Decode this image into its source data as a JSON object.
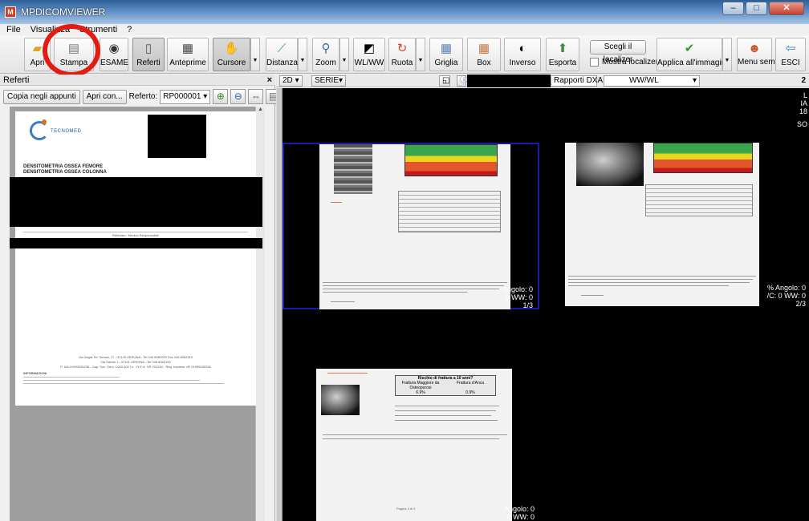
{
  "window": {
    "title": "MPDICOMVIEWER",
    "minimize": "–",
    "maximize": "□",
    "close": "✕"
  },
  "menu": [
    "File",
    "Visualizza",
    "Strumenti",
    "?"
  ],
  "toolbar": {
    "apri": "Apri",
    "stampa": "Stampa",
    "esame": "ESAME",
    "referti": "Referti",
    "anteprime": "Anteprime",
    "cursore": "Cursore",
    "distanza": "Distanza",
    "zoom": "Zoom",
    "wlww": "WL/WW",
    "ruota": "Ruota",
    "griglia": "Griglia",
    "box": "Box",
    "inverso": "Inverso",
    "esporta": "Esporta",
    "scegli_localizer": "Scegli il localizer",
    "mostra_localizer": "Mostra localizer",
    "applica": "Applica all'immagine",
    "menu_semplice": "Menu semplice",
    "esci": "ESCI"
  },
  "left_panel": {
    "title": "Referti",
    "close": "×",
    "copy_btn": "Copia negli appunti",
    "open_btn": "Apri con...",
    "referto_label": "Referto:",
    "referto_value": "RP000001"
  },
  "document": {
    "logo_text": "TECNOMED",
    "heading1": "DENSITOMETRIA OSSEA FEMORE",
    "heading2": "DENSITOMETRIA OSSEA COLONNA",
    "signature_line": "Refertato / Medico Responsabile",
    "address_line1": "Via Sagra Ter Tomasi, 17 - 37129 VERONA - Tel 045 8062200 Fax 045 8062210",
    "address_line2": "Via Salvini 1 - 37121 VERONA - Tel 045 8062100",
    "address_line3": "P. IVA 01990030238 - Cap. Soc. Euro 1.000.000 i.v. - R.E.A. VR 201254 - Reg. Imprese VR 01990030238",
    "footer_heading": "INFORMAZIONI"
  },
  "viewer_bar": {
    "mode": "2D",
    "series": "SERIE",
    "reports": "Rapporti DXA",
    "wwwl": "WW/WL",
    "page_indicator": "2"
  },
  "viewer": {
    "right_edge_text": [
      "L",
      "IA",
      "18",
      "SO"
    ],
    "cell1_overlay": [
      "Angolo: 0",
      "0 WW: 0",
      "1/3"
    ],
    "cell2_overlay": [
      "% Angolo: 0",
      "/C: 0 WW: 0",
      "2/3"
    ],
    "cell3_overlay": [
      "Angolo: 0",
      "0 WW: 0"
    ],
    "cell3_title": "Rischio di frattura a 10 anni?",
    "cell3_col1": "Frattura Maggiore da Osteoporosi",
    "cell3_col2": "Frattura d'Anca",
    "cell3_val1": "6.9%",
    "cell3_val2": "0.9%",
    "cell3_page_foot": "Pagina 3 di 3"
  }
}
